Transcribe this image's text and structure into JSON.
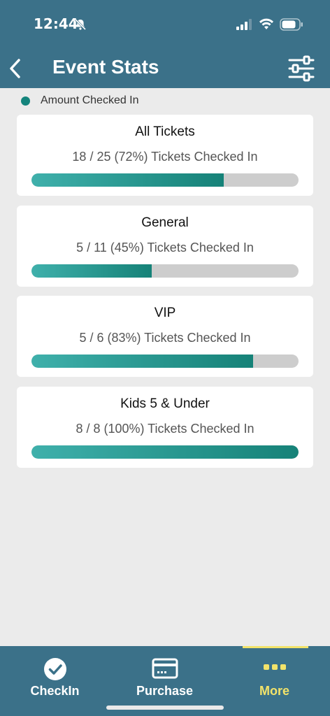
{
  "status_bar": {
    "time": "12:44",
    "icons": [
      "bell-muted-icon",
      "signal-icon",
      "wifi-icon",
      "battery-icon"
    ]
  },
  "header": {
    "title": "Event Stats",
    "back_icon": "chevron-left-icon",
    "filter_icon": "sliders-icon"
  },
  "legend": {
    "label": "Amount Checked In",
    "color": "#14847c"
  },
  "cards": [
    {
      "title": "All Tickets",
      "stat": "18 / 25 (72%) Tickets Checked In",
      "progress": 0.72
    },
    {
      "title": "General",
      "stat": "5 / 11 (45%) Tickets Checked In",
      "progress": 0.45
    },
    {
      "title": "VIP",
      "stat": "5 / 6 (83%) Tickets Checked In",
      "progress": 0.83
    },
    {
      "title": "Kids 5 & Under",
      "stat": "8 / 8 (100%) Tickets Checked In",
      "progress": 1.0
    }
  ],
  "tabbar": {
    "tabs": [
      {
        "label": "CheckIn",
        "icon": "check-circle-icon",
        "active": false
      },
      {
        "label": "Purchase",
        "icon": "credit-card-icon",
        "active": false
      },
      {
        "label": "More",
        "icon": "more-dots-icon",
        "active": true
      }
    ]
  },
  "colors": {
    "header_bg": "#3b7189",
    "accent": "#f2e36a",
    "progress_start": "#3fb0ab",
    "progress_end": "#168278",
    "track": "#cdcdcd",
    "background": "#ebebeb"
  }
}
